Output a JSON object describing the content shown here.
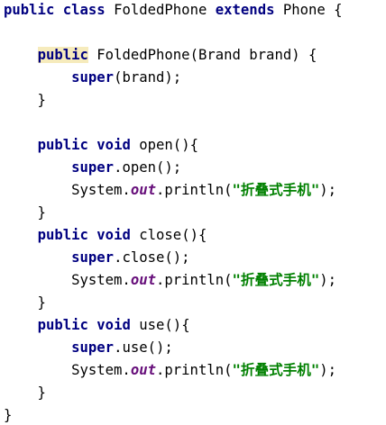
{
  "code_lines": [
    {
      "t": [
        {
          "s": "public",
          "c": "kw"
        },
        {
          "s": " "
        },
        {
          "s": "class",
          "c": "kw"
        },
        {
          "s": " FoldedPhone "
        },
        {
          "s": "extends",
          "c": "kw"
        },
        {
          "s": " Phone {"
        }
      ]
    },
    {
      "t": []
    },
    {
      "t": [
        {
          "s": "    "
        },
        {
          "s": "public",
          "c": "kw hl"
        },
        {
          "s": " FoldedPhone(Brand brand) {"
        }
      ]
    },
    {
      "t": [
        {
          "s": "        "
        },
        {
          "s": "super",
          "c": "kw"
        },
        {
          "s": "(brand);"
        }
      ]
    },
    {
      "t": [
        {
          "s": "    }"
        }
      ]
    },
    {
      "t": []
    },
    {
      "t": [
        {
          "s": "    "
        },
        {
          "s": "public",
          "c": "kw"
        },
        {
          "s": " "
        },
        {
          "s": "void",
          "c": "kw"
        },
        {
          "s": " open(){"
        }
      ]
    },
    {
      "t": [
        {
          "s": "        "
        },
        {
          "s": "super",
          "c": "kw"
        },
        {
          "s": ".open();"
        }
      ]
    },
    {
      "t": [
        {
          "s": "        System."
        },
        {
          "s": "out",
          "c": "fld"
        },
        {
          "s": ".println("
        },
        {
          "s": "\"折叠式手机\"",
          "c": "str"
        },
        {
          "s": ");"
        }
      ]
    },
    {
      "t": [
        {
          "s": "    }"
        }
      ]
    },
    {
      "t": [
        {
          "s": "    "
        },
        {
          "s": "public",
          "c": "kw"
        },
        {
          "s": " "
        },
        {
          "s": "void",
          "c": "kw"
        },
        {
          "s": " close(){"
        }
      ]
    },
    {
      "t": [
        {
          "s": "        "
        },
        {
          "s": "super",
          "c": "kw"
        },
        {
          "s": ".close();"
        }
      ]
    },
    {
      "t": [
        {
          "s": "        System."
        },
        {
          "s": "out",
          "c": "fld"
        },
        {
          "s": ".println("
        },
        {
          "s": "\"折叠式手机\"",
          "c": "str"
        },
        {
          "s": ");"
        }
      ]
    },
    {
      "t": [
        {
          "s": "    }"
        }
      ]
    },
    {
      "t": [
        {
          "s": "    "
        },
        {
          "s": "public",
          "c": "kw"
        },
        {
          "s": " "
        },
        {
          "s": "void",
          "c": "kw"
        },
        {
          "s": " use(){"
        }
      ]
    },
    {
      "t": [
        {
          "s": "        "
        },
        {
          "s": "super",
          "c": "kw"
        },
        {
          "s": ".use();"
        }
      ]
    },
    {
      "t": [
        {
          "s": "        System."
        },
        {
          "s": "out",
          "c": "fld"
        },
        {
          "s": ".println("
        },
        {
          "s": "\"折叠式手机\"",
          "c": "str"
        },
        {
          "s": ");"
        }
      ]
    },
    {
      "t": [
        {
          "s": "    }"
        }
      ]
    },
    {
      "t": [
        {
          "s": "}"
        }
      ]
    }
  ],
  "colors": {
    "keyword": "#000080",
    "field": "#660e7a",
    "string": "#008000",
    "highlight": "#f6ebbc",
    "background": "#ffffff"
  }
}
